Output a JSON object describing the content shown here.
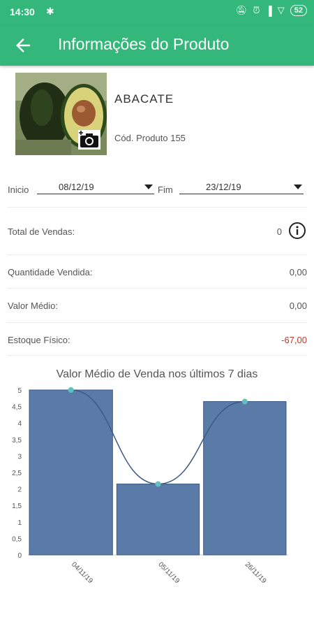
{
  "status_bar": {
    "time": "14:30",
    "battery": "52"
  },
  "app_bar": {
    "title": "Informações do Produto"
  },
  "product": {
    "name": "ABACATE",
    "code": "Cód. Produto 155"
  },
  "period": {
    "start_label": "Inicio",
    "start_value": "08/12/19",
    "end_label": "Fim",
    "end_value": "23/12/19"
  },
  "stats": {
    "total_vendas": {
      "label": "Total de Vendas:",
      "value": "0"
    },
    "quantidade_vendida": {
      "label": "Quantidade Vendida:",
      "value": "0,00"
    },
    "valor_medio": {
      "label": "Valor Médio:",
      "value": "0,00"
    },
    "estoque_fisico": {
      "label": "Estoque Físico:",
      "value": "-67,00"
    }
  },
  "colors": {
    "brand": "#34b77a",
    "bar": "#5a7aa8",
    "line": "#3d5a85",
    "point": "#5ec2c0",
    "negative": "#c0392b"
  },
  "chart_data": {
    "type": "bar",
    "title": "Valor Médio de Venda nos últimos 7 dias",
    "categories": [
      "04/11/19",
      "05/11/19",
      "26/11/19"
    ],
    "values": [
      5,
      2.15,
      4.65
    ],
    "ylim": [
      0,
      5
    ],
    "yticks": [
      "0",
      "0,5",
      "1",
      "1,5",
      "2",
      "2,5",
      "3",
      "3,5",
      "4",
      "4,5",
      "5"
    ],
    "overlay": "smoothed line through bar tops",
    "grid": false,
    "legend": "none"
  }
}
